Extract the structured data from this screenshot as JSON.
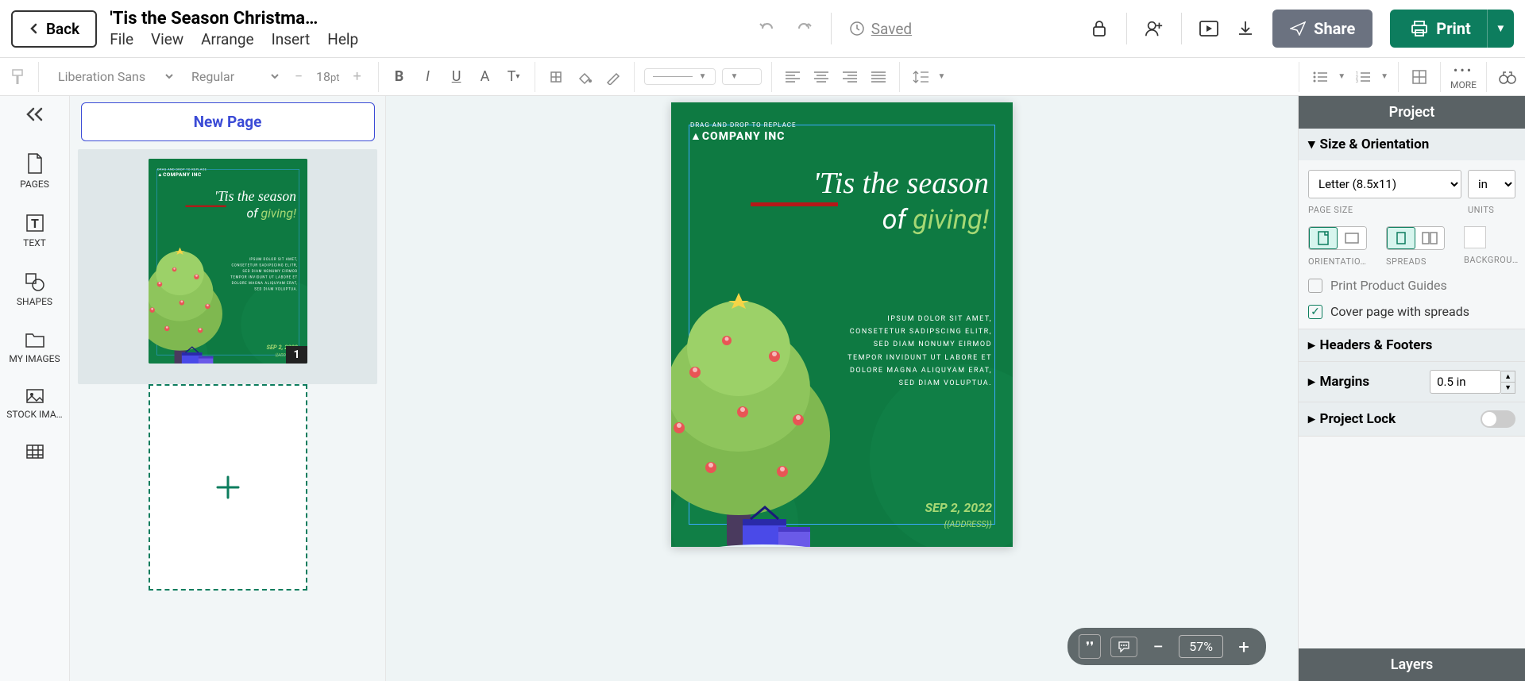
{
  "header": {
    "back": "Back",
    "title": "'Tis the Season Christma…",
    "menu": [
      "File",
      "View",
      "Arrange",
      "Insert",
      "Help"
    ],
    "saved": "Saved",
    "share": "Share",
    "print": "Print"
  },
  "toolbar": {
    "font": "Liberation Sans",
    "weight": "Regular",
    "size": "18",
    "sizeUnit": "pt",
    "more": "MORE"
  },
  "sidenav": {
    "pages": "PAGES",
    "text": "TEXT",
    "shapes": "SHAPES",
    "myimg": "MY IMAGES",
    "stock": "STOCK IMA…"
  },
  "pages": {
    "newPage": "New Page",
    "thumbNum": "1"
  },
  "canvas": {
    "logoTag": "DRAG AND DROP TO REPLACE",
    "company": "COMPANY INC",
    "head1": "'Tis the season",
    "head2a": "of ",
    "head2b": "giving!",
    "body": "IPSUM DOLOR SIT AMET, CONSETETUR SADIPSCING ELITR, SED DIAM NONUMY EIRMOD TEMPOR INVIDUNT UT LABORE ET DOLORE MAGNA ALIQUYAM ERAT, SED DIAM VOLUPTUA.",
    "date": "SEP 2, 2022",
    "addr": "{{ADDRESS}}"
  },
  "zoom": "57%",
  "panel": {
    "project": "Project",
    "size": "Size & Orientation",
    "pageSize": "Letter (8.5x11)",
    "units": "in",
    "lblPageSize": "PAGE SIZE",
    "lblUnits": "UNITS",
    "lblOrient": "ORIENTATIO…",
    "lblSpreads": "SPREADS",
    "lblBg": "BACKGROU…",
    "printGuides": "Print Product Guides",
    "coverSpreads": "Cover page with spreads",
    "headers": "Headers & Footers",
    "margins": "Margins",
    "marginVal": "0.5 in",
    "lock": "Project Lock",
    "layers": "Layers"
  }
}
